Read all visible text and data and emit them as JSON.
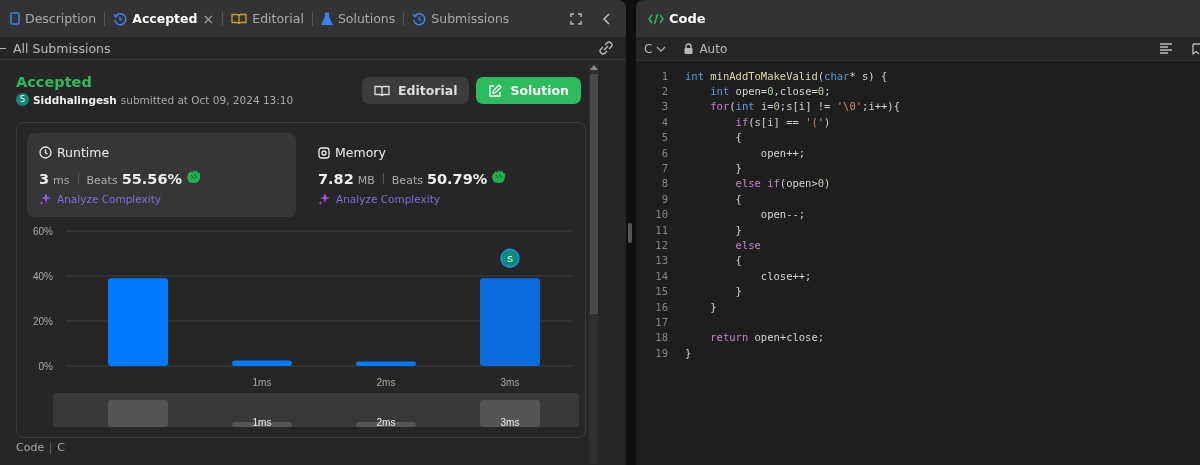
{
  "tabs": [
    {
      "label": "Description",
      "selected": false,
      "closable": false
    },
    {
      "label": "Accepted",
      "selected": true,
      "closable": true
    },
    {
      "label": "Editorial",
      "selected": false,
      "closable": false
    },
    {
      "label": "Solutions",
      "selected": false,
      "closable": false
    },
    {
      "label": "Submissions",
      "selected": false,
      "closable": false
    }
  ],
  "close_glyph": "×",
  "back_link": "All Submissions",
  "submission": {
    "status": "Accepted",
    "avatar": "S",
    "user": "Siddhalingesh",
    "submitted": "submitted at Oct 09, 2024 13:10",
    "buttons": [
      {
        "label": "Editorial",
        "kind": "secondary"
      },
      {
        "label": "Solution",
        "kind": "primary"
      }
    ]
  },
  "stats": [
    {
      "title": "Runtime",
      "value": "3",
      "unit": "ms",
      "beats_label": "Beats",
      "beats": "55.56%",
      "analyze": "Analyze Complexity",
      "selected": true
    },
    {
      "title": "Memory",
      "value": "7.82",
      "unit": "MB",
      "beats_label": "Beats",
      "beats": "50.79%",
      "analyze": "Analyze Complexity",
      "selected": false
    }
  ],
  "chart_data": {
    "type": "bar",
    "categories": [
      null,
      "1ms",
      "2ms",
      "3ms"
    ],
    "values": [
      39,
      2.5,
      2,
      39
    ],
    "ylim": [
      0,
      60
    ],
    "yticks": [
      {
        "value": 0,
        "label": "0%"
      },
      {
        "value": 20,
        "label": "20%"
      },
      {
        "value": 40,
        "label": "40%"
      },
      {
        "value": 60,
        "label": "60%"
      }
    ]
  },
  "chart_avatar": "S",
  "overview_labels": [
    "1ms",
    "2ms",
    "3ms"
  ],
  "bottom_tabs": [
    "Code",
    "C"
  ],
  "editor": {
    "title": "Code",
    "language": "C",
    "mode": "Auto",
    "lines": [
      {
        "number": "1",
        "tokens": [
          {
            "kind": "type",
            "text": "int"
          },
          {
            "kind": "func",
            "text": " minAddToMakeValid"
          },
          {
            "kind": "plain",
            "text": "("
          },
          {
            "kind": "type",
            "text": "char"
          },
          {
            "kind": "plain",
            "text": "* s) {"
          }
        ]
      },
      {
        "number": "2",
        "tokens": [
          {
            "kind": "type",
            "text": "    int"
          },
          {
            "kind": "plain",
            "text": " open="
          },
          {
            "kind": "number",
            "text": "0"
          },
          {
            "kind": "plain",
            "text": ",close="
          },
          {
            "kind": "number",
            "text": "0"
          },
          {
            "kind": "plain",
            "text": ";"
          }
        ]
      },
      {
        "number": "3",
        "tokens": [
          {
            "kind": "keyword",
            "text": "    for"
          },
          {
            "kind": "plain",
            "text": "("
          },
          {
            "kind": "type",
            "text": "int"
          },
          {
            "kind": "plain",
            "text": " i="
          },
          {
            "kind": "number",
            "text": "0"
          },
          {
            "kind": "plain",
            "text": ";s[i] != "
          },
          {
            "kind": "string",
            "text": "'\\0'"
          },
          {
            "kind": "plain",
            "text": ";i++){"
          }
        ]
      },
      {
        "number": "4",
        "tokens": [
          {
            "kind": "keyword",
            "text": "        if"
          },
          {
            "kind": "plain",
            "text": "(s[i] == "
          },
          {
            "kind": "string",
            "text": "'('"
          },
          {
            "kind": "plain",
            "text": ")"
          }
        ]
      },
      {
        "number": "5",
        "tokens": [
          {
            "kind": "plain",
            "text": "        {"
          }
        ]
      },
      {
        "number": "6",
        "tokens": [
          {
            "kind": "plain",
            "text": "            open++;"
          }
        ]
      },
      {
        "number": "7",
        "tokens": [
          {
            "kind": "plain",
            "text": "        }"
          }
        ]
      },
      {
        "number": "8",
        "tokens": [
          {
            "kind": "keyword",
            "text": "        else if"
          },
          {
            "kind": "plain",
            "text": "(open>"
          },
          {
            "kind": "number",
            "text": "0"
          },
          {
            "kind": "plain",
            "text": ")"
          }
        ]
      },
      {
        "number": "9",
        "tokens": [
          {
            "kind": "plain",
            "text": "        {"
          }
        ]
      },
      {
        "number": "10",
        "tokens": [
          {
            "kind": "plain",
            "text": "            open--;"
          }
        ]
      },
      {
        "number": "11",
        "tokens": [
          {
            "kind": "plain",
            "text": "        }"
          }
        ]
      },
      {
        "number": "12",
        "tokens": [
          {
            "kind": "keyword",
            "text": "        else"
          }
        ]
      },
      {
        "number": "13",
        "tokens": [
          {
            "kind": "plain",
            "text": "        {"
          }
        ]
      },
      {
        "number": "14",
        "tokens": [
          {
            "kind": "plain",
            "text": "            close++;"
          }
        ]
      },
      {
        "number": "15",
        "tokens": [
          {
            "kind": "plain",
            "text": "        }"
          }
        ]
      },
      {
        "number": "16",
        "tokens": [
          {
            "kind": "plain",
            "text": "    }"
          }
        ]
      },
      {
        "number": "17"
      },
      {
        "number": "18",
        "tokens": [
          {
            "kind": "keyword",
            "text": "    return"
          },
          {
            "kind": "plain",
            "text": " open+close;"
          }
        ]
      },
      {
        "number": "19",
        "tokens": [
          {
            "kind": "plain",
            "text": "}"
          }
        ]
      }
    ]
  }
}
